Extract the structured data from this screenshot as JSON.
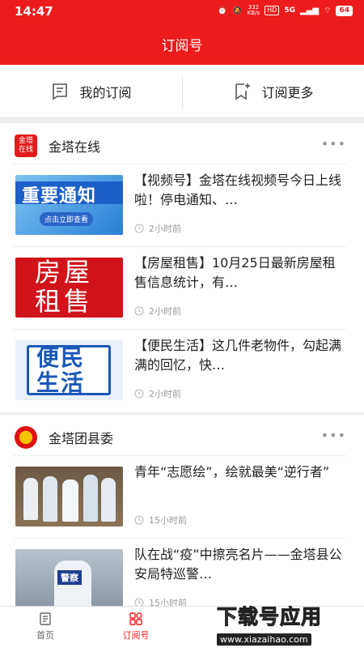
{
  "status": {
    "time": "14:47",
    "speed_top": "332",
    "speed_bottom": "KB/s",
    "hd": "HD",
    "net": "5G",
    "battery": "64"
  },
  "header": {
    "title": "订阅号"
  },
  "subbar": {
    "my_label": "我的订阅",
    "more_label": "订阅更多"
  },
  "channels": [
    {
      "name": "金塔在线",
      "logo_text": "金塔在线",
      "more": "•••",
      "items": [
        {
          "title": "【视频号】金塔在线视频号今日上线啦！停电通知、…",
          "time": "2小时前",
          "thumb_text_1": "重要通知",
          "thumb_text_2": "点击立即查看"
        },
        {
          "title": "【房屋租售】10月25日最新房屋租售信息统计，有…",
          "time": "2小时前",
          "thumb_text_1": "房屋",
          "thumb_text_2": "租售"
        },
        {
          "title": "【便民生活】这几件老物件，勾起满满的回忆，快…",
          "time": "2小时前",
          "thumb_text_1": "便民",
          "thumb_text_2": "生活"
        }
      ]
    },
    {
      "name": "金塔团县委",
      "more": "•••",
      "items": [
        {
          "title": "青年“志愿绘”，绘就最美“逆行者”",
          "time": "15小时前"
        },
        {
          "title": "队在战“疫”中擦亮名片——金塔县公安局特巡警…",
          "time": "15小时前",
          "thumb_text_1": "警察"
        }
      ]
    }
  ],
  "bottomnav": {
    "home_label": "首页",
    "subscribe_label": "订阅号"
  },
  "watermark": {
    "big": "下载号应用",
    "small": "www.xiazaihao.com"
  },
  "colors": {
    "brand_red": "#ec1c1c"
  }
}
